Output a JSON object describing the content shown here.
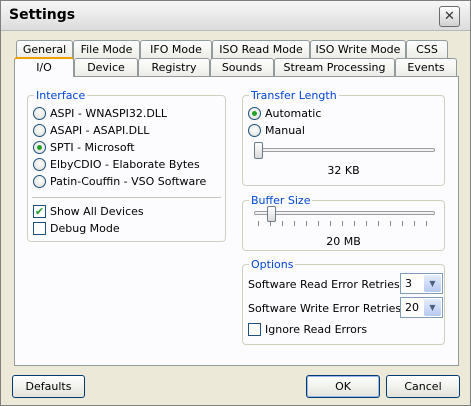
{
  "window": {
    "title": "Settings"
  },
  "tabs_back": [
    "General",
    "File Mode",
    "IFO Mode",
    "ISO Read Mode",
    "ISO Write Mode",
    "CSS"
  ],
  "tabs_front": [
    "I/O",
    "Device",
    "Registry",
    "Sounds",
    "Stream Processing",
    "Events"
  ],
  "active_tab": "I/O",
  "interface": {
    "title": "Interface",
    "options": [
      "ASPI - WNASPI32.DLL",
      "ASAPI - ASAPI.DLL",
      "SPTI - Microsoft",
      "ElbyCDIO - Elaborate Bytes",
      "Patin-Couffin - VSO Software"
    ],
    "selected": "SPTI - Microsoft",
    "show_all_devices": {
      "label": "Show All Devices",
      "checked": true
    },
    "debug_mode": {
      "label": "Debug Mode",
      "checked": false
    }
  },
  "transfer_length": {
    "title": "Transfer Length",
    "options": [
      "Automatic",
      "Manual"
    ],
    "selected": "Automatic",
    "value_label": "32 KB",
    "slider_fraction": 0.0
  },
  "buffer_size": {
    "title": "Buffer Size",
    "value_label": "20 MB",
    "slider_fraction": 0.08
  },
  "options": {
    "title": "Options",
    "read_retries": {
      "label": "Software Read Error Retries:",
      "value": "3"
    },
    "write_retries": {
      "label": "Software Write Error Retries:",
      "value": "20"
    },
    "ignore_read_errors": {
      "label": "Ignore Read Errors",
      "checked": false
    }
  },
  "buttons": {
    "defaults": "Defaults",
    "ok": "OK",
    "cancel": "Cancel"
  }
}
